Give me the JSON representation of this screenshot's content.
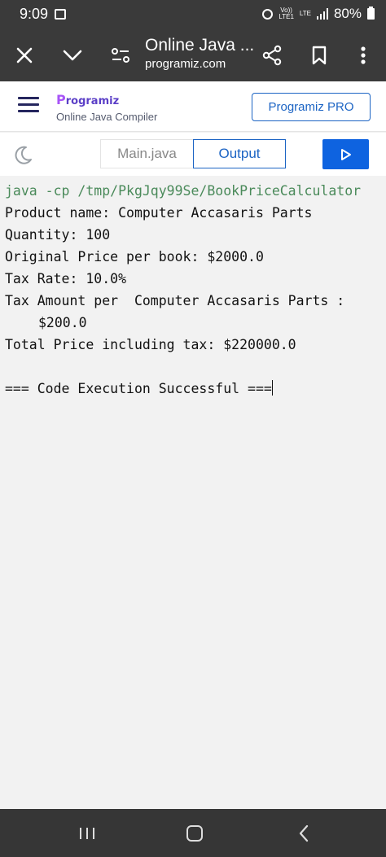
{
  "status_bar": {
    "time": "9:09",
    "volte_line1": "Vo))",
    "volte_line2": "LTE1",
    "lte_label": "LTE",
    "battery": "80%"
  },
  "browser": {
    "title": "Online Java ...",
    "url": "programiz.com"
  },
  "site": {
    "logo_text": "rogramiz",
    "subtitle": "Online Java Compiler",
    "pro_button": "Programiz PRO"
  },
  "tabs": [
    {
      "label": "Main.java"
    },
    {
      "label": "Output"
    }
  ],
  "output": {
    "command": "java -cp /tmp/PkgJqy99Se/BookPriceCalculator",
    "lines": [
      "Product name: Computer Accasaris Parts",
      "Quantity: 100",
      "Original Price per book: $2000.0",
      "Tax Rate: 10.0%",
      "Tax Amount per  Computer Accasaris Parts :",
      "$200.0",
      "Total Price including tax: $220000.0",
      "=== Code Execution Successful ==="
    ]
  },
  "icons": {
    "close": "close-icon",
    "chevron": "chevron-down-icon",
    "tune": "page-info-icon",
    "share": "share-icon",
    "bookmark": "bookmark-icon",
    "more": "more-vert-icon",
    "moon": "dark-mode-icon",
    "run": "play-icon"
  },
  "colors": {
    "accent": "#0e63e0",
    "brand": "#5b3fc7",
    "command_text": "#4a8a5a"
  }
}
